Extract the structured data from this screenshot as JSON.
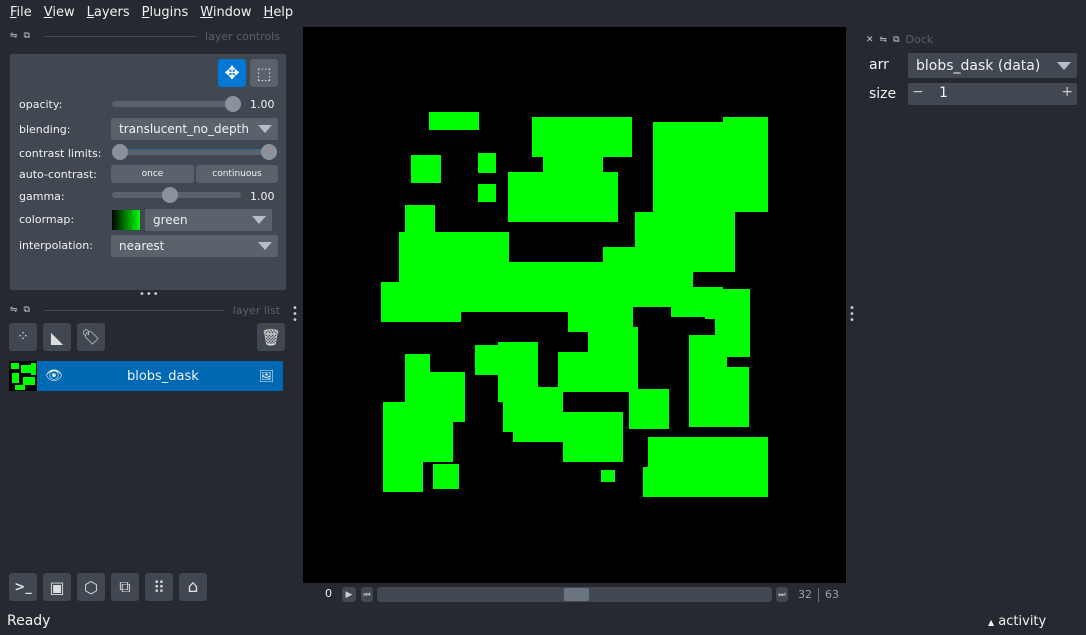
{
  "menu": [
    "File",
    "View",
    "Layers",
    "Plugins",
    "Window",
    "Help"
  ],
  "layer_controls": {
    "title": "layer controls",
    "opacity_label": "opacity:",
    "opacity_value": "1.00",
    "opacity": 1.0,
    "blending_label": "blending:",
    "blending": "translucent_no_depth",
    "contrast_label": "contrast limits:",
    "contrast_limits": [
      0,
      1
    ],
    "auto_contrast_label": "auto-contrast:",
    "once": "once",
    "continuous": "continuous",
    "gamma_label": "gamma:",
    "gamma_value": "1.00",
    "gamma": 1.0,
    "colormap_label": "colormap:",
    "colormap": "green",
    "interpolation_label": "interpolation:",
    "interpolation": "nearest"
  },
  "layer_list": {
    "title": "layer list",
    "layers": [
      {
        "name": "blobs_dask",
        "visible": true,
        "type": "image"
      }
    ]
  },
  "dims": {
    "start": "0",
    "current": "32",
    "max": "63"
  },
  "dock": {
    "title": "Dock",
    "arr_label": "arr",
    "arr_value": "blobs_dask (data)",
    "size_label": "size",
    "size_value": "1",
    "minus": "−",
    "plus": "+"
  },
  "status": "Ready",
  "activity": "activity",
  "colors": {
    "accent": "#0070c0",
    "blob": "#00ff00"
  }
}
